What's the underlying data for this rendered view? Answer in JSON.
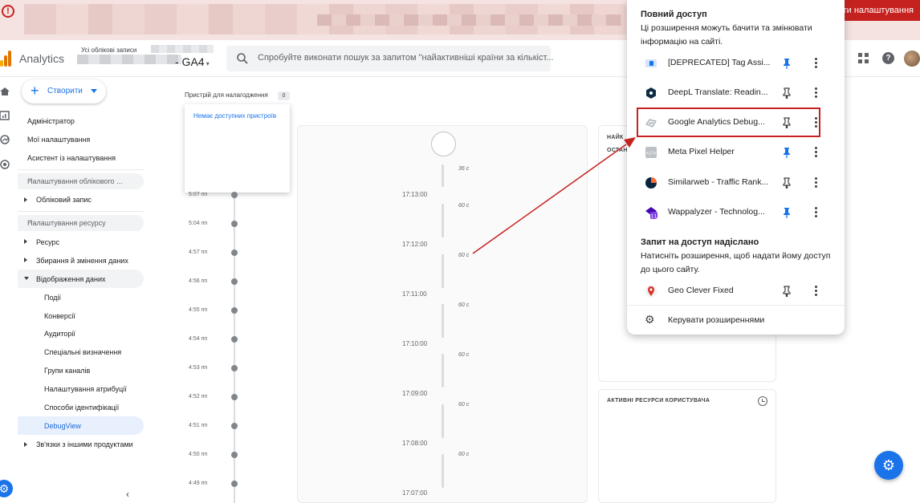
{
  "banner": {
    "setup_label": "ити налаштування",
    "colors": {
      "background": "#f5e3e1",
      "button": "#c5221f"
    }
  },
  "header": {
    "app_name": "Analytics",
    "account_label": "Усі облікові записи",
    "property_name": "- GA4",
    "search_placeholder": "Спробуйте виконати пошук за запитом \"найактивніші країни за кількіст..."
  },
  "sidebar": {
    "create_label": "Створити",
    "top_items": [
      "Адміністратор",
      "Мої налаштування",
      "Асистент із налаштування"
    ],
    "account_section": "Налаштування облікового ...",
    "account_items": [
      "Обліковий запис"
    ],
    "property_section": "Налаштування ресурсу",
    "property_items": [
      "Ресурс",
      "Збирання й змінення даних",
      "Відображення даних"
    ],
    "display_subitems": [
      "Події",
      "Конверсії",
      "Аудиторії",
      "Спеціальні визначення",
      "Групи каналів",
      "Налаштування атрибуції",
      "Способи ідентифікації",
      "DebugView"
    ],
    "linked_label": "Зв'язки з іншими продуктами"
  },
  "debug": {
    "devices_label": "Пристрій для налагодження",
    "devices_count": "0",
    "no_devices": "Немає доступних пристроїв",
    "minutes": [
      "5:07 пп",
      "5:04 пп",
      "4:57 пп",
      "4:56 пп",
      "4:55 пп",
      "4:54 пп",
      "4:53 пп",
      "4:52 пп",
      "4:51 пп",
      "4:50 пп",
      "4:49 пп"
    ],
    "seconds_times": [
      "17:13:00",
      "17:12:00",
      "17:11:00",
      "17:10:00",
      "17:09:00",
      "17:08:00",
      "17:07:00"
    ],
    "seconds_durations": [
      "36 с",
      "60 с",
      "60 с",
      "60 с",
      "60 с",
      "60 с",
      "60 с"
    ]
  },
  "cards": {
    "top_card_title_line1": "НАЙК",
    "top_card_title_line2": "ОСТАН",
    "user_props_title": "АКТИВНІ РЕСУРСИ КОРИСТУВАЧА"
  },
  "extensions_popup": {
    "full_access_title": "Повний доступ",
    "full_access_desc": "Ці розширення можуть бачити та змінювати інформацію на сайті.",
    "extensions": [
      {
        "name": "[DEPRECATED] Tag Assi...",
        "icon": "tag-assistant-icon",
        "pinned": true
      },
      {
        "name": "DeepL Translate: Readin...",
        "icon": "deepl-icon",
        "pinned": false
      },
      {
        "name": "Google Analytics Debug...",
        "icon": "ga-debugger-icon",
        "pinned": false,
        "highlighted": true
      },
      {
        "name": "Meta Pixel Helper",
        "icon": "meta-pixel-icon",
        "pinned": true
      },
      {
        "name": "Similarweb - Traffic Rank...",
        "icon": "similarweb-icon",
        "pinned": false
      },
      {
        "name": "Wappalyzer - Technolog...",
        "icon": "wappalyzer-icon",
        "pinned": true
      }
    ],
    "request_title": "Запит на доступ надіслано",
    "request_desc": "Натисніть розширення, щоб надати йому доступ до цього сайту.",
    "request_extensions": [
      {
        "name": "Geo Clever Fixed",
        "icon": "geo-clever-icon",
        "pinned": false
      }
    ],
    "manage_label": "Керувати розширеннями",
    "colors": {
      "pinned": "#1a73e8",
      "highlight": "#c5221f",
      "arrow": "#c5221f"
    }
  }
}
